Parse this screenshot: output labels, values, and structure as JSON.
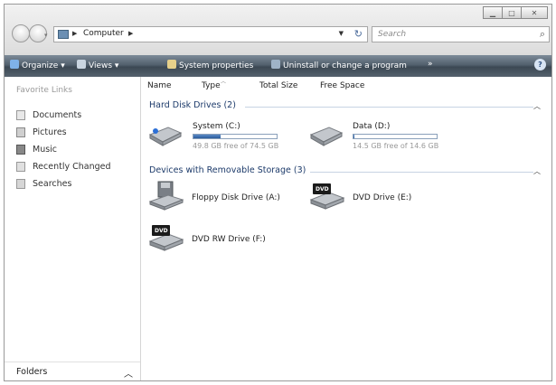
{
  "window": {
    "address": {
      "icon": "computer-icon",
      "path": [
        "Computer"
      ]
    },
    "search": {
      "placeholder": "Search"
    },
    "controls": {
      "minimize": "minimize-icon",
      "maximize": "maximize-icon",
      "close": "close-icon"
    }
  },
  "toolbar": {
    "items": [
      {
        "label": "Organize",
        "icon": "organize-icon"
      },
      {
        "label": "Views",
        "icon": "views-icon"
      },
      {
        "label": "System properties",
        "icon": "system-properties-icon"
      },
      {
        "label": "Uninstall or change a program",
        "icon": "uninstall-icon"
      }
    ],
    "overflow": "»",
    "help": "?"
  },
  "nav_pane": {
    "title": "Favorite Links",
    "items": [
      {
        "label": "Documents",
        "icon": "documents-icon"
      },
      {
        "label": "Pictures",
        "icon": "pictures-icon"
      },
      {
        "label": "Music",
        "icon": "music-icon"
      },
      {
        "label": "Recently Changed",
        "icon": "recently-changed-icon"
      },
      {
        "label": "Searches",
        "icon": "searches-icon"
      }
    ],
    "folders_label": "Folders"
  },
  "columns": [
    "Name",
    "Type",
    "Total Size",
    "Free Space"
  ],
  "groups": {
    "hard_disks": {
      "title": "Hard Disk Drives (2)",
      "drives": [
        {
          "name": "System (C:)",
          "free_text": "49.8 GB free of 74.5 GB",
          "used_fraction": 0.33
        },
        {
          "name": "Data (D:)",
          "free_text": "14.5 GB free of 14.6 GB",
          "used_fraction": 0.01
        }
      ]
    },
    "removable": {
      "title": "Devices with Removable Storage (3)",
      "devices": [
        {
          "name": "Floppy Disk Drive (A:)",
          "icon": "floppy-drive-icon"
        },
        {
          "name": "DVD Drive (E:)",
          "icon": "dvd-drive-icon",
          "badge": "DVD"
        },
        {
          "name": "DVD RW Drive (F:)",
          "icon": "dvd-rw-drive-icon",
          "badge": "DVD"
        }
      ]
    }
  }
}
